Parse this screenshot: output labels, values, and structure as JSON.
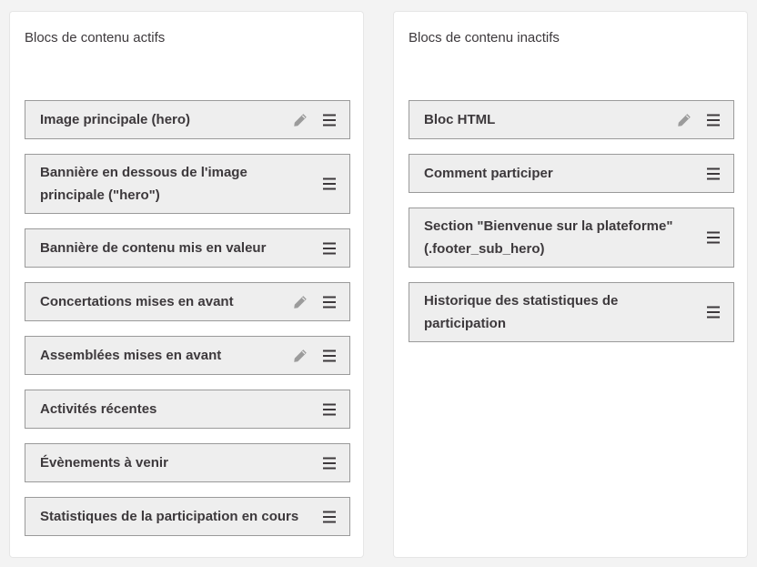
{
  "active": {
    "title": "Blocs de contenu actifs",
    "items": [
      {
        "label": "Image principale (hero)",
        "editable": true
      },
      {
        "label": "Bannière en dessous de l'image principale (\"hero\")",
        "editable": false
      },
      {
        "label": "Bannière de contenu mis en valeur",
        "editable": false
      },
      {
        "label": "Concertations mises en avant",
        "editable": true
      },
      {
        "label": "Assemblées mises en avant",
        "editable": true
      },
      {
        "label": "Activités récentes",
        "editable": false
      },
      {
        "label": "Évènements à venir",
        "editable": false
      },
      {
        "label": "Statistiques de la participation en cours",
        "editable": false
      }
    ]
  },
  "inactive": {
    "title": "Blocs de contenu inactifs",
    "items": [
      {
        "label": "Bloc HTML",
        "editable": true
      },
      {
        "label": "Comment participer",
        "editable": false
      },
      {
        "label": "Section \"Bienvenue sur la plateforme\" (.footer_sub_hero)",
        "editable": false
      },
      {
        "label": "Historique des statistiques de participation",
        "editable": false
      }
    ]
  },
  "icons": {
    "edit": "pencil-icon",
    "drag": "drag-handle-icon"
  },
  "colors": {
    "item_background": "#eeeeee",
    "item_border": "#9a9a9a",
    "text": "#3d393c",
    "icon_muted": "#9b9b9b"
  }
}
